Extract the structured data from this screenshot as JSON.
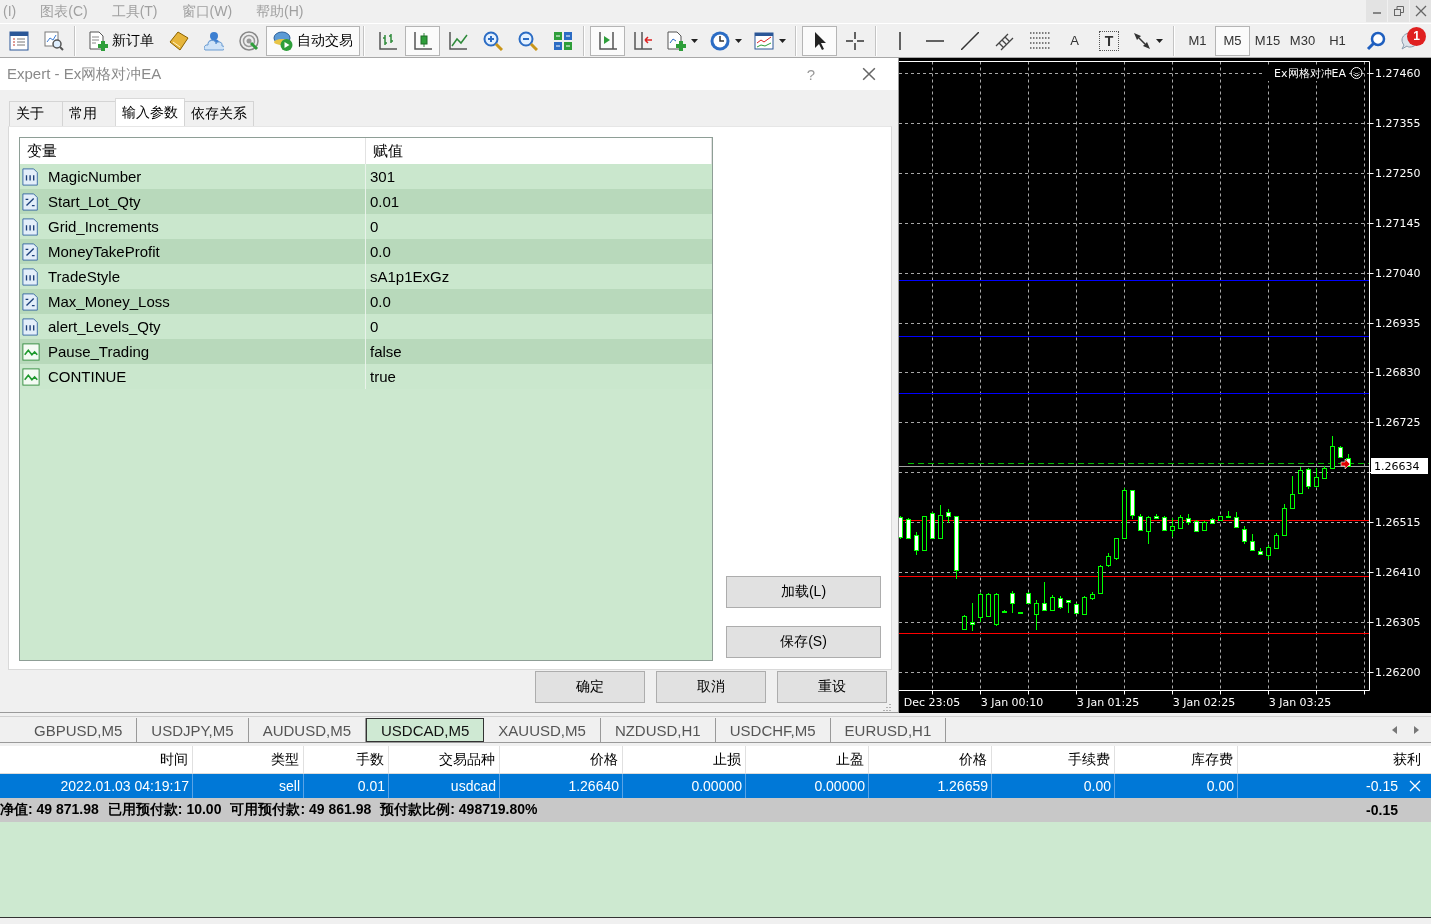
{
  "menu": [
    {
      "label": "(I)",
      "disabled": true
    },
    {
      "label": "图表(C)",
      "disabled": true
    },
    {
      "label": "工具(T)",
      "disabled": true
    },
    {
      "label": "窗口(W)",
      "disabled": true
    },
    {
      "label": "帮助(H)",
      "disabled": true
    }
  ],
  "toolbar": {
    "groups": [
      [
        {
          "kind": "icon",
          "pressed": false
        },
        {
          "kind": "icon",
          "pressed": false
        }
      ],
      [
        {
          "kind": "icon_label",
          "label": "新订单",
          "pressed": false
        },
        {
          "kind": "icon",
          "pressed": false
        },
        {
          "kind": "icon",
          "pressed": false
        },
        {
          "kind": "icon",
          "pressed": false
        },
        {
          "kind": "icon_label",
          "label": "自动交易",
          "pressed": true
        }
      ],
      [
        {
          "kind": "icon",
          "pressed": false
        },
        {
          "kind": "icon",
          "pressed": true
        },
        {
          "kind": "icon",
          "pressed": false
        },
        {
          "kind": "icon",
          "pressed": false
        },
        {
          "kind": "icon",
          "pressed": false
        },
        {
          "kind": "icon",
          "pressed": false
        }
      ],
      [
        {
          "kind": "icon",
          "pressed": true
        },
        {
          "kind": "icon",
          "pressed": false
        },
        {
          "kind": "menu_icon",
          "pressed": false
        },
        {
          "kind": "menu_icon",
          "pressed": false
        },
        {
          "kind": "menu_icon",
          "pressed": false
        }
      ],
      [
        {
          "kind": "icon",
          "pressed": true
        },
        {
          "kind": "icon",
          "pressed": false
        }
      ],
      [
        {
          "kind": "icon",
          "pressed": false
        },
        {
          "kind": "icon",
          "pressed": false
        },
        {
          "kind": "icon",
          "pressed": false
        },
        {
          "kind": "icon",
          "pressed": false
        },
        {
          "kind": "icon",
          "pressed": false
        },
        {
          "kind": "label",
          "label": "A",
          "pressed": false
        },
        {
          "kind": "boxed_label",
          "label": "T",
          "pressed": false
        },
        {
          "kind": "menu_icon",
          "pressed": false
        }
      ],
      [
        {
          "kind": "label",
          "label": "M1",
          "pressed": false
        },
        {
          "kind": "label",
          "label": "M5",
          "pressed": true
        },
        {
          "kind": "label",
          "label": "M15",
          "pressed": false
        },
        {
          "kind": "label",
          "label": "M30",
          "pressed": false
        },
        {
          "kind": "label",
          "label": "H1",
          "pressed": false
        }
      ],
      [
        {
          "kind": "icon",
          "pressed": false
        },
        {
          "kind": "badge_icon",
          "badge": "1",
          "pressed": false
        }
      ]
    ]
  },
  "dialog": {
    "title": "Expert - Ex网格对冲EA",
    "help": "?",
    "tabs": [
      {
        "label": "关于",
        "selected": false
      },
      {
        "label": "常用",
        "selected": false
      },
      {
        "label": "输入参数",
        "selected": true
      },
      {
        "label": "依存关系",
        "selected": false
      }
    ],
    "inputs": {
      "columns": [
        "变量",
        "赋值"
      ],
      "rows": [
        {
          "kind": "int",
          "name": "MagicNumber",
          "value": "301"
        },
        {
          "kind": "double",
          "name": "Start_Lot_Qty",
          "value": "0.01"
        },
        {
          "kind": "int",
          "name": "Grid_Increments",
          "value": "0"
        },
        {
          "kind": "double",
          "name": "MoneyTakeProfit",
          "value": "0.0"
        },
        {
          "kind": "int",
          "name": "TradeStyle",
          "value": "sA1p1ExGz"
        },
        {
          "kind": "double",
          "name": "Max_Money_Loss",
          "value": "0.0"
        },
        {
          "kind": "int",
          "name": "alert_Levels_Qty",
          "value": "0"
        },
        {
          "kind": "bool",
          "name": "Pause_Trading",
          "value": "false"
        },
        {
          "kind": "bool",
          "name": "CONTINUE",
          "value": "true"
        }
      ]
    },
    "side_buttons": [
      "加载(L)",
      "保存(S)"
    ],
    "buttons": [
      "确定",
      "取消",
      "重设"
    ]
  },
  "chart": {
    "ea_label": "Ex网格对冲EA",
    "price_tag": "1.26634",
    "chart_data": {
      "type": "candlestick",
      "categories": [
        null,
        null,
        null,
        null,
        "Dec 23:05",
        null,
        null,
        null,
        null,
        null,
        null,
        null,
        null,
        null,
        "3 Jan 00:10",
        null,
        null,
        null,
        null,
        null,
        null,
        null,
        null,
        null,
        null,
        null,
        "3 Jan 01:25",
        null,
        null,
        null,
        null,
        null,
        null,
        null,
        null,
        null,
        null,
        null,
        "3 Jan 02:25",
        null,
        null,
        null,
        null,
        null,
        null,
        null,
        null,
        null,
        null,
        null,
        "3 Jan 03:25",
        null,
        null,
        null,
        null,
        null,
        null
      ],
      "ohlc": [
        [
          1.26525,
          1.26528,
          1.26479,
          1.26483
        ],
        [
          1.26521,
          1.26523,
          1.26479,
          1.26481
        ],
        [
          1.26488,
          1.26495,
          1.26445,
          1.26457
        ],
        [
          1.26457,
          1.26529,
          1.26456,
          1.26528
        ],
        [
          1.26534,
          1.26537,
          1.26479,
          1.26481
        ],
        [
          1.26481,
          1.26552,
          1.2648,
          1.2653
        ],
        [
          1.26536,
          1.26543,
          1.26513,
          1.26529
        ],
        [
          1.26528,
          1.26529,
          1.26395,
          1.26415
        ],
        [
          1.26291,
          1.2632,
          1.26289,
          1.26318
        ],
        [
          1.26305,
          1.26346,
          1.26286,
          1.263
        ],
        [
          1.26315,
          1.26366,
          1.26306,
          1.26364
        ],
        [
          1.26318,
          1.26366,
          1.26315,
          1.26364
        ],
        [
          1.263,
          1.26366,
          1.26297,
          1.26364
        ],
        [
          1.26329,
          1.2633,
          1.26327,
          1.26328
        ],
        [
          1.26367,
          1.26371,
          1.26324,
          1.26344
        ],
        [
          1.26327,
          1.26327,
          1.26325,
          1.26325
        ],
        [
          1.26367,
          1.26368,
          1.26344,
          1.26346
        ],
        [
          1.26322,
          1.26351,
          1.26289,
          1.26346
        ],
        [
          1.26346,
          1.26389,
          1.26328,
          1.2633
        ],
        [
          1.2633,
          1.26361,
          1.26328,
          1.26358
        ],
        [
          1.26355,
          1.26359,
          1.26333,
          1.26336
        ],
        [
          1.26351,
          1.26351,
          1.26324,
          1.26347
        ],
        [
          1.26343,
          1.26346,
          1.26321,
          1.26324
        ],
        [
          1.26322,
          1.26359,
          1.26321,
          1.26357
        ],
        [
          1.26355,
          1.26368,
          1.26351,
          1.26364
        ],
        [
          1.26367,
          1.26426,
          1.26366,
          1.26423
        ],
        [
          1.26424,
          1.2645,
          1.26421,
          1.26444
        ],
        [
          1.26439,
          1.26481,
          1.26436,
          1.26481
        ],
        [
          1.26481,
          1.26587,
          1.26479,
          1.26583
        ],
        [
          1.26583,
          1.26583,
          1.26521,
          1.2653
        ],
        [
          1.26528,
          1.26532,
          1.26497,
          1.26499
        ],
        [
          1.26497,
          1.26528,
          1.2647,
          1.26525
        ],
        [
          1.26529,
          1.26532,
          1.26521,
          1.26523
        ],
        [
          1.26526,
          1.26528,
          1.26498,
          1.26499
        ],
        [
          1.26499,
          1.26523,
          1.26483,
          1.26506
        ],
        [
          1.26503,
          1.2653,
          1.265,
          1.26526
        ],
        [
          1.26523,
          1.26532,
          1.2651,
          1.26516
        ],
        [
          1.26517,
          1.26519,
          1.26495,
          1.26497
        ],
        [
          1.26498,
          1.26518,
          1.26497,
          1.26516
        ],
        [
          1.26521,
          1.26523,
          1.26513,
          1.26514
        ],
        [
          1.26519,
          1.26529,
          1.26517,
          1.26528
        ],
        [
          1.26529,
          1.26538,
          1.26523,
          1.26525
        ],
        [
          1.26526,
          1.26537,
          1.26502,
          1.26504
        ],
        [
          1.26501,
          1.26506,
          1.2647,
          1.26475
        ],
        [
          1.26475,
          1.2649,
          1.26454,
          1.26457
        ],
        [
          1.26455,
          1.26461,
          1.26445,
          1.26448
        ],
        [
          1.26445,
          1.26466,
          1.26435,
          1.26463
        ],
        [
          1.26461,
          1.26492,
          1.26459,
          1.26488
        ],
        [
          1.26488,
          1.26554,
          1.26486,
          1.26544
        ],
        [
          1.26545,
          1.26612,
          1.26543,
          1.26575
        ],
        [
          1.26576,
          1.26631,
          1.26575,
          1.26625
        ],
        [
          1.26627,
          1.2663,
          1.26585,
          1.26592
        ],
        [
          1.26592,
          1.2663,
          1.26591,
          1.2661
        ],
        [
          1.26607,
          1.26634,
          1.26606,
          1.2663
        ],
        [
          1.2663,
          1.26696,
          1.26628,
          1.26676
        ],
        [
          1.26674,
          1.26676,
          1.26649,
          1.26652
        ],
        [
          1.26649,
          1.26658,
          1.26631,
          1.26634
        ]
      ],
      "ylim": [
        1.26161,
        1.27484
      ],
      "yticks": [
        {
          "value": 1.2746,
          "label": "1.27460"
        },
        {
          "value": 1.27355,
          "label": "1.27355"
        },
        {
          "value": 1.2725,
          "label": "1.27250"
        },
        {
          "value": 1.27145,
          "label": "1.27145"
        },
        {
          "value": 1.2704,
          "label": "1.27040"
        },
        {
          "value": 1.26935,
          "label": "1.26935"
        },
        {
          "value": 1.2683,
          "label": "1.26830"
        },
        {
          "value": 1.26725,
          "label": "1.26725"
        },
        {
          "value": 1.26515,
          "label": "1.26515"
        },
        {
          "value": 1.2641,
          "label": "1.26410"
        },
        {
          "value": 1.26305,
          "label": "1.26305"
        },
        {
          "value": 1.262,
          "label": "1.26200"
        }
      ],
      "grid": true,
      "ref_lines": [
        {
          "axis": "y",
          "value": 1.27025,
          "color": "#0000ff"
        },
        {
          "axis": "y",
          "value": 1.26906,
          "color": "#0000ff"
        },
        {
          "axis": "y",
          "value": 1.26786,
          "color": "#0000ff"
        },
        {
          "axis": "y",
          "value": 1.2652,
          "color": "#ff0000"
        },
        {
          "axis": "y",
          "value": 1.26401,
          "color": "#ff0000"
        },
        {
          "axis": "y",
          "value": 1.26282,
          "color": "#ff0000"
        },
        {
          "axis": "y",
          "value": 1.2664,
          "color": "#00c000"
        },
        {
          "axis": "y",
          "value": 1.26634,
          "color": "#a0a0a0"
        }
      ]
    }
  },
  "chart_tabs": [
    {
      "label": "GBPUSD,M5",
      "selected": false
    },
    {
      "label": "USDJPY,M5",
      "selected": false
    },
    {
      "label": "AUDUSD,M5",
      "selected": false
    },
    {
      "label": "USDCAD,M5",
      "selected": true
    },
    {
      "label": "XAUUSD,M5",
      "selected": false
    },
    {
      "label": "NZDUSD,H1",
      "selected": false
    },
    {
      "label": "USDCHF,M5",
      "selected": false
    },
    {
      "label": "EURUSD,H1",
      "selected": false
    }
  ],
  "trade_table": {
    "columns": [
      "时间",
      "类型",
      "手数",
      "交易品种",
      "价格",
      "止损",
      "止盈",
      "价格",
      "手续费",
      "库存费",
      "获利"
    ],
    "rows": [
      {
        "cells": [
          "2022.01.03 04:19:17",
          "sell",
          "0.01",
          "usdcad",
          "1.26640",
          "0.00000",
          "0.00000",
          "1.26659",
          "0.00",
          "0.00",
          "-0.15"
        ],
        "selected": true
      }
    ],
    "summary": {
      "items": [
        "净值: 49 871.98",
        "已用预付款: 10.00",
        "可用预付款: 49 861.98",
        "预付款比例: 498719.80%"
      ],
      "total": "-0.15"
    }
  }
}
